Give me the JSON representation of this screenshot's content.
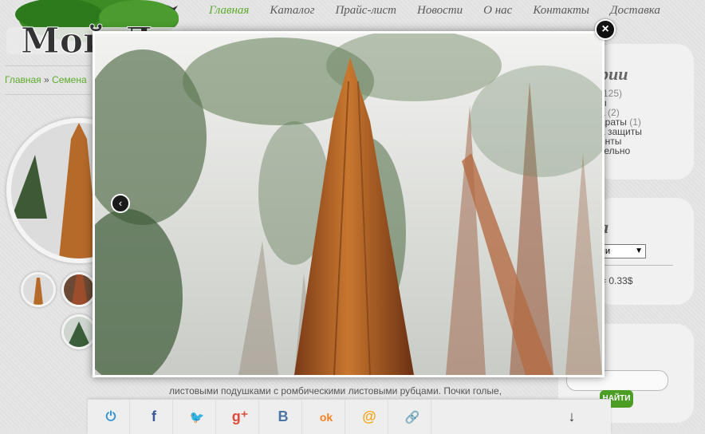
{
  "nav": {
    "items": [
      {
        "label": "Главная",
        "active": true
      },
      {
        "label": "Каталог"
      },
      {
        "label": "Прайс-лист"
      },
      {
        "label": "Новости"
      },
      {
        "label": "О нас"
      },
      {
        "label": "Контакты"
      },
      {
        "label": "Доставка"
      }
    ]
  },
  "logo": {
    "text": "Мой Лес"
  },
  "breadcrumb": {
    "home": "Главная",
    "sep": "»",
    "section": "Семена"
  },
  "categories_panel": {
    "title": "рии",
    "items": [
      {
        "label": "",
        "count": "(125)"
      },
      {
        "label": "ы",
        "count": ""
      },
      {
        "label": "а",
        "count": "(2)"
      },
      {
        "label": "араты",
        "count": "(1)"
      },
      {
        "label": "а защиты",
        "count": ""
      },
      {
        "label": "енты",
        "count": ""
      },
      {
        "label": "тельно",
        "count": ""
      }
    ]
  },
  "currency_panel": {
    "title": "а",
    "selected": "пи",
    "price": "= 0.33$"
  },
  "search_panel": {
    "button": "НАЙТИ"
  },
  "description": {
    "text": "листовыми подушками с ромбическими листовыми рубцами. Почки голые,"
  },
  "share_bar": {
    "items": [
      {
        "icon": "power-icon",
        "glyph": "⏻",
        "color": "#2a8fd6"
      },
      {
        "icon": "facebook-icon",
        "glyph": "f",
        "color": "#3b5998"
      },
      {
        "icon": "twitter-icon",
        "glyph": "🐦",
        "color": "#1da1f2"
      },
      {
        "icon": "googleplus-icon",
        "glyph": "g⁺",
        "color": "#dd4b39"
      },
      {
        "icon": "vk-icon",
        "glyph": "В",
        "color": "#4c75a3"
      },
      {
        "icon": "odnoklassniki-icon",
        "glyph": "ok",
        "color": "#f58220"
      },
      {
        "icon": "mailru-icon",
        "glyph": "@",
        "color": "#f5a623"
      },
      {
        "icon": "link-icon",
        "glyph": "🔗",
        "color": "#3b5998"
      }
    ],
    "more_glyph": "↓"
  },
  "lightbox": {
    "close_glyph": "×",
    "prev_glyph": "‹"
  }
}
